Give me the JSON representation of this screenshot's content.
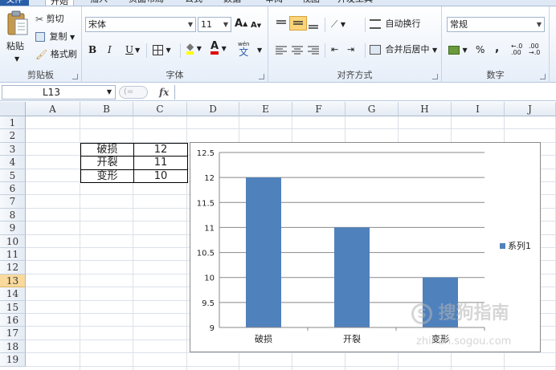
{
  "ribbon": {
    "tabs": [
      "文件",
      "开始",
      "插入",
      "页面布局",
      "公式",
      "数据",
      "审阅",
      "视图",
      "开发工具"
    ],
    "clipboard": {
      "label": "剪贴板",
      "paste": "粘贴",
      "cut": "剪切",
      "copy": "复制",
      "format_painter": "格式刷"
    },
    "font": {
      "label": "字体",
      "name": "宋体",
      "size": "11",
      "bold": "B",
      "italic": "I",
      "underline": "U",
      "wen": "wén",
      "wen_char": "文",
      "grow": "A",
      "shrink": "A"
    },
    "alignment": {
      "label": "对齐方式",
      "wrap": "自动换行",
      "merge": "合并后居中"
    },
    "number": {
      "label": "数字",
      "format": "常规",
      "percent": "%",
      "comma": ","
    }
  },
  "formula_bar": {
    "name_box": "L13",
    "fx": "fx",
    "hint": "(="
  },
  "sheet": {
    "columns": [
      "A",
      "B",
      "C",
      "D",
      "E",
      "F",
      "G",
      "H",
      "I",
      "J"
    ],
    "rows": [
      "1",
      "2",
      "3",
      "4",
      "5",
      "6",
      "7",
      "8",
      "9",
      "10",
      "11",
      "12",
      "13",
      "14",
      "15",
      "16",
      "17",
      "18",
      "19"
    ],
    "selected_row": "13",
    "table": [
      {
        "label": "破损",
        "value": "12"
      },
      {
        "label": "开裂",
        "value": "11"
      },
      {
        "label": "变形",
        "value": "10"
      }
    ]
  },
  "chart_data": {
    "type": "bar",
    "categories": [
      "破损",
      "开裂",
      "变形"
    ],
    "series": [
      {
        "name": "系列1",
        "values": [
          12,
          11,
          10
        ],
        "color": "#4f81bd"
      }
    ],
    "ylim": [
      9,
      12.5
    ],
    "yticks": [
      "9",
      "9.5",
      "10",
      "10.5",
      "11",
      "11.5",
      "12",
      "12.5"
    ],
    "legend": "right",
    "grid": true
  },
  "watermark": {
    "text": "搜狗指南",
    "url": "zhinan.sogou.com"
  }
}
